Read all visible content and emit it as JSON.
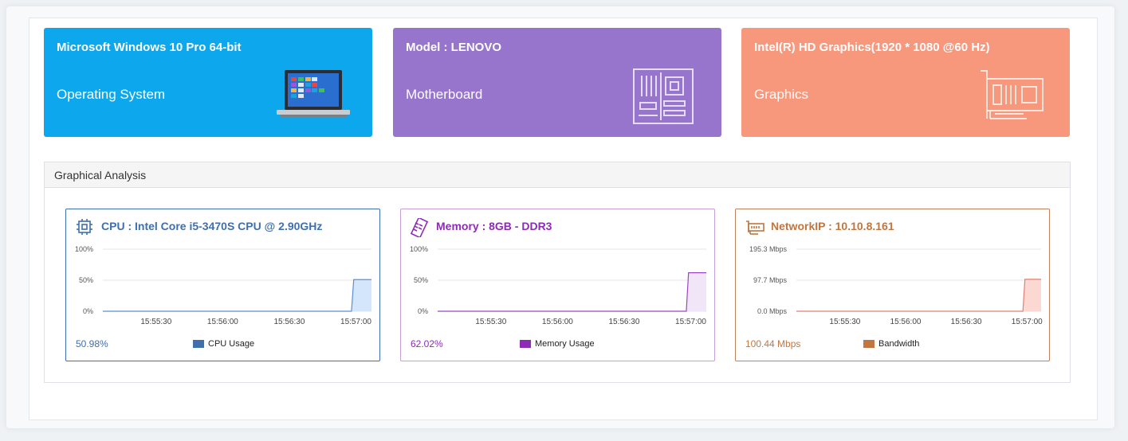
{
  "cards": {
    "os": {
      "title": "Microsoft Windows 10 Pro 64-bit",
      "subtitle": "Operating System",
      "color": "#0ca7ec",
      "icon": "laptop-icon"
    },
    "motherboard": {
      "title": "Model : LENOVO",
      "subtitle": "Motherboard",
      "color": "#9775cc",
      "icon": "motherboard-icon"
    },
    "graphics": {
      "title": "Intel(R) HD Graphics(1920 * 1080 @60 Hz)",
      "subtitle": "Graphics",
      "color": "#f7977b",
      "icon": "graphics-card-icon"
    }
  },
  "graphical_analysis": {
    "title": "Graphical Analysis",
    "monitors": {
      "cpu": {
        "title": "CPU : Intel Core i5-3470S CPU @ 2.90GHz",
        "icon": "cpu-icon",
        "value": "50.98%",
        "legend": "CPU Usage",
        "color": "#3f6fac",
        "fill": "#d4e6fb",
        "line": "#5b8fd6"
      },
      "memory": {
        "title": "Memory : 8GB - DDR3",
        "icon": "ram-icon",
        "value": "62.02%",
        "legend": "Memory Usage",
        "color": "#8e2bb6",
        "fill": "#f1e6f8",
        "line": "#9d45c5"
      },
      "network": {
        "title": "NetworkIP : 10.10.8.161",
        "icon": "network-card-icon",
        "value": "100.44 Mbps",
        "legend": "Bandwidth",
        "color": "#c0763e",
        "fill": "#fcd8d3",
        "line": "#e08070"
      }
    }
  },
  "chart_data": [
    {
      "type": "area",
      "series": [
        {
          "name": "CPU Usage",
          "x": [
            "15:55:06",
            "15:56:58",
            "15:56:59",
            "15:57:07"
          ],
          "values": [
            0,
            0,
            50.98,
            50.98
          ]
        }
      ],
      "ytick_labels": [
        "0%",
        "50%",
        "100%"
      ],
      "xtick_labels": [
        "15:55:30",
        "15:56:00",
        "15:56:30",
        "15:57:00"
      ],
      "ylim": [
        0,
        100
      ],
      "grid": true
    },
    {
      "type": "area",
      "series": [
        {
          "name": "Memory Usage",
          "x": [
            "15:55:06",
            "15:56:58",
            "15:56:59",
            "15:57:07"
          ],
          "values": [
            0,
            0,
            62.02,
            62.02
          ]
        }
      ],
      "ytick_labels": [
        "0%",
        "50%",
        "100%"
      ],
      "xtick_labels": [
        "15:55:30",
        "15:56:00",
        "15:56:30",
        "15:57:00"
      ],
      "ylim": [
        0,
        100
      ],
      "grid": true
    },
    {
      "type": "area",
      "series": [
        {
          "name": "Bandwidth",
          "x": [
            "15:55:06",
            "15:56:58",
            "15:56:59",
            "15:57:07"
          ],
          "values": [
            0,
            0,
            100.44,
            100.44
          ]
        }
      ],
      "ytick_labels": [
        "0.0 Mbps",
        "97.7 Mbps",
        "195.3 Mbps"
      ],
      "xtick_labels": [
        "15:55:30",
        "15:56:00",
        "15:56:30",
        "15:57:00"
      ],
      "ylim": [
        0,
        195.3
      ],
      "grid": true
    }
  ]
}
